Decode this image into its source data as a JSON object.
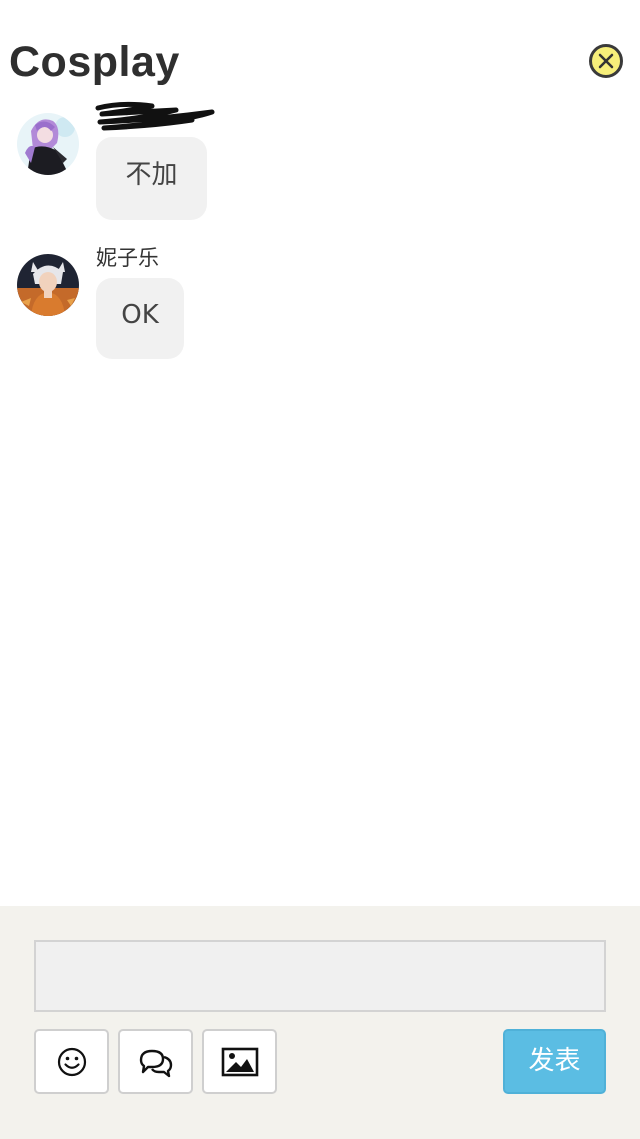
{
  "header": {
    "title": "Cosplay",
    "close_icon": "close-circle-icon",
    "close_color": "#f7ef7a"
  },
  "messages": [
    {
      "username": "",
      "username_redacted": true,
      "text": "不加",
      "avatar": "anime-girl-purple-hair-avatar"
    },
    {
      "username": "妮子乐",
      "username_redacted": false,
      "text": "OK",
      "avatar": "anime-boy-white-hair-avatar"
    }
  ],
  "composer": {
    "input_value": "",
    "input_placeholder": "",
    "tools": [
      {
        "icon": "smiley-icon"
      },
      {
        "icon": "speech-bubbles-icon"
      },
      {
        "icon": "image-icon"
      }
    ],
    "send_label": "发表",
    "send_color": "#5bbde3"
  }
}
